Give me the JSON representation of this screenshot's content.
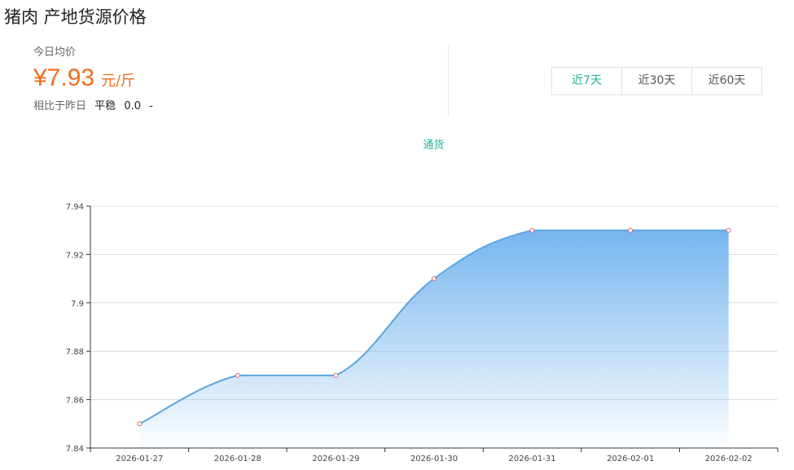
{
  "header": {
    "title": "猪肉 产地货源价格"
  },
  "summary": {
    "label": "今日均价",
    "price": "¥7.93",
    "unit": "元/斤",
    "compare_label": "相比于昨日",
    "trend": "平稳",
    "change": "0.0",
    "change_suffix": "-"
  },
  "range_tabs": [
    {
      "label": "近7天",
      "active": true
    },
    {
      "label": "近30天",
      "active": false
    },
    {
      "label": "近60天",
      "active": false
    }
  ],
  "colors": {
    "accent": "#1fb39b",
    "price": "#f06d1a",
    "line": "#5aa5e0",
    "area_top": "#6fb1ee",
    "point_stroke": "#e0666a"
  },
  "chart_data": {
    "type": "area",
    "x": [
      "2026-01-27",
      "2026-01-28",
      "2026-01-29",
      "2026-01-30",
      "2026-01-31",
      "2026-02-01",
      "2026-02-02"
    ],
    "series": [
      {
        "name": "通货",
        "values": [
          7.85,
          7.87,
          7.87,
          7.91,
          7.93,
          7.93,
          7.93
        ]
      }
    ],
    "ylim": [
      7.84,
      7.94
    ],
    "yticks": [
      "7.84",
      "7.86",
      "7.88",
      "7.9",
      "7.92",
      "7.94"
    ],
    "grid": true,
    "smooth": true,
    "legend_position": "top-center"
  }
}
